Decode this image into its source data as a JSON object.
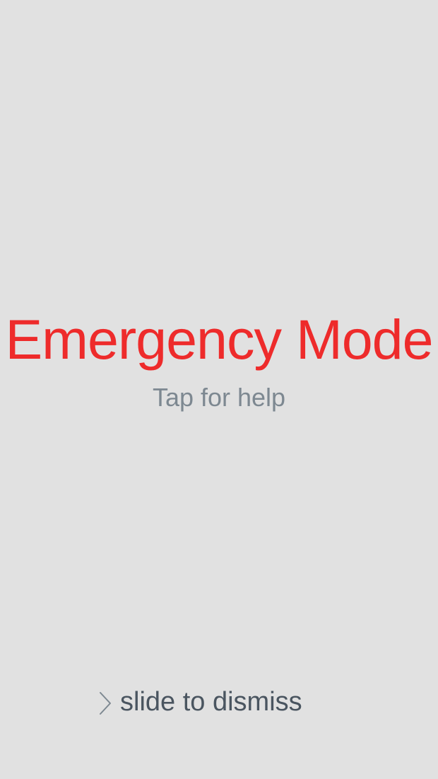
{
  "screen": {
    "title": "Emergency Mode",
    "help_text": "Tap for help",
    "dismiss_label": "slide to dismiss",
    "icons": {
      "dismiss_chevron": "chevron-right-icon"
    },
    "colors": {
      "background": "#e1e1e1",
      "title": "#ee2b2b",
      "help_text": "#7d8891",
      "dismiss_text": "#4a5560"
    }
  }
}
